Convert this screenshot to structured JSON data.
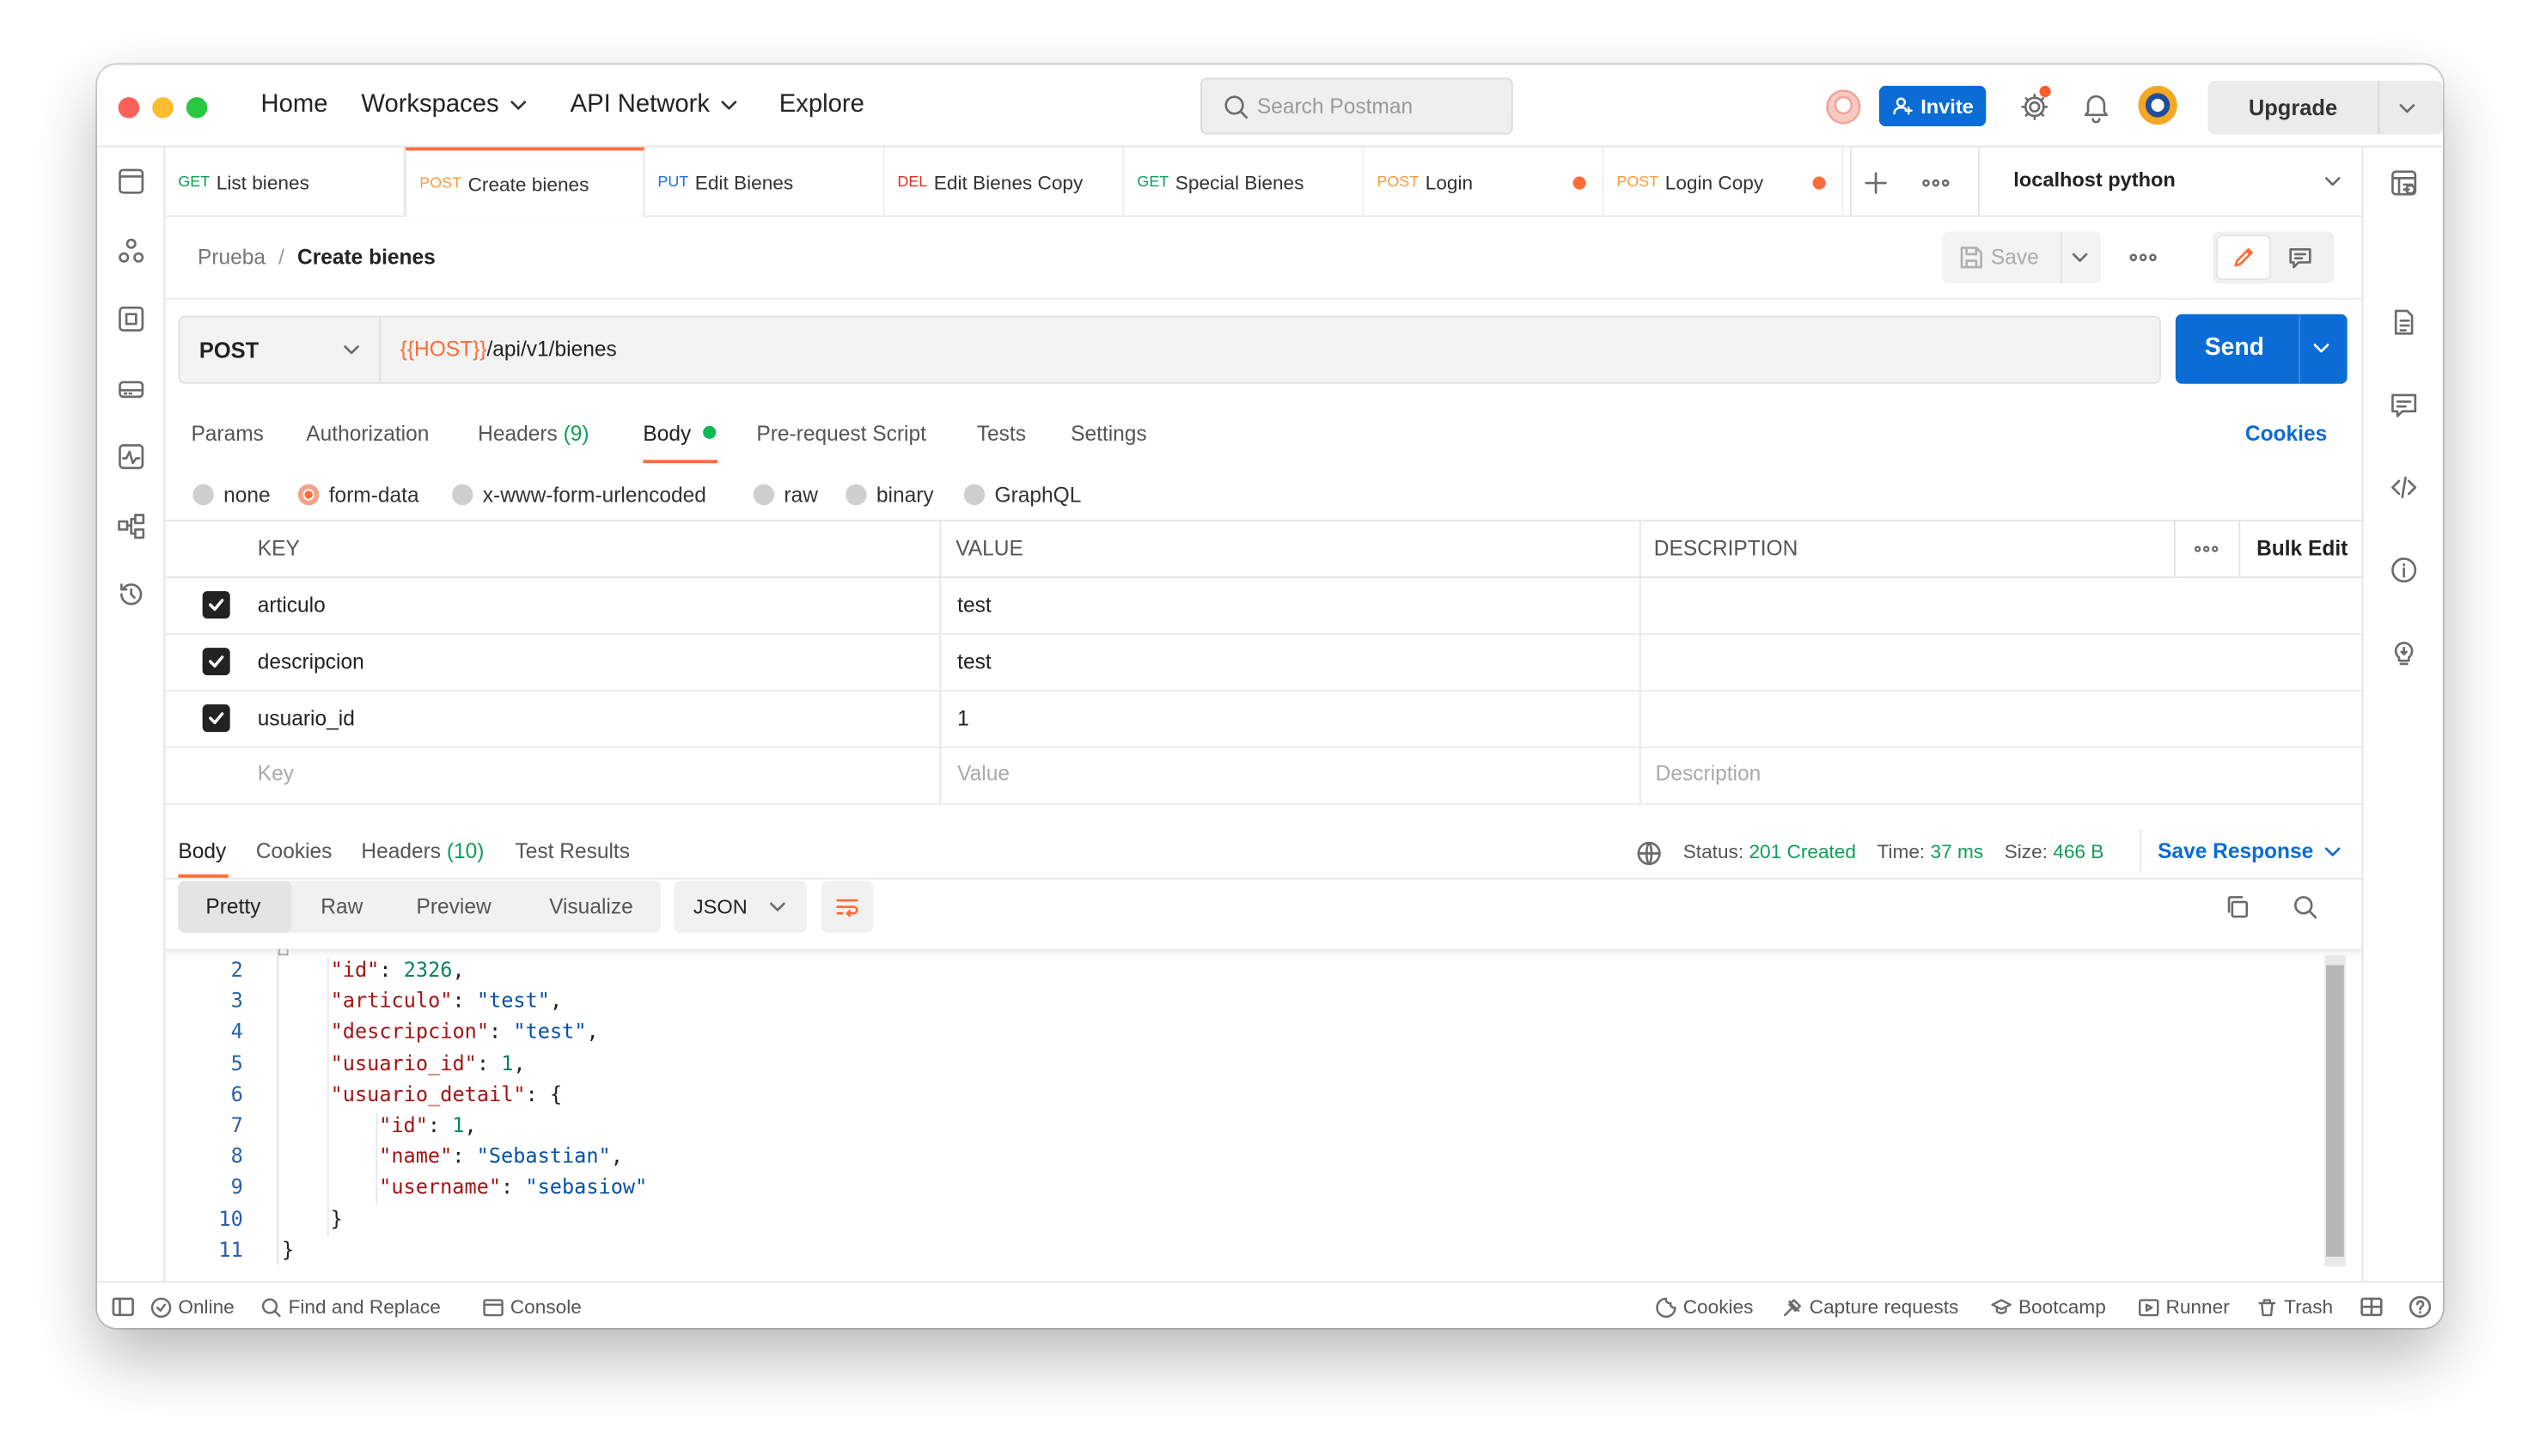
{
  "titlebar": {
    "nav": [
      {
        "label": "Home"
      },
      {
        "label": "Workspaces"
      },
      {
        "label": "API Network"
      },
      {
        "label": "Explore"
      }
    ],
    "search_placeholder": "Search Postman",
    "invite_label": "Invite",
    "upgrade_label": "Upgrade"
  },
  "tabs": [
    {
      "method": "GET",
      "name": "List bienes",
      "color": "#0f9d58",
      "active": false,
      "dot": false
    },
    {
      "method": "POST",
      "name": "Create bienes",
      "color": "#ff9a3c",
      "active": true,
      "dot": false
    },
    {
      "method": "PUT",
      "name": "Edit Bienes",
      "color": "#1a73e8",
      "active": false,
      "dot": false
    },
    {
      "method": "DEL",
      "name": "Edit Bienes Copy",
      "color": "#d93025",
      "active": false,
      "dot": false
    },
    {
      "method": "GET",
      "name": "Special Bienes",
      "color": "#0f9d58",
      "active": false,
      "dot": false
    },
    {
      "method": "POST",
      "name": "Login",
      "color": "#ff9a3c",
      "active": false,
      "dot": true
    },
    {
      "method": "POST",
      "name": "Login Copy",
      "color": "#ff9a3c",
      "active": false,
      "dot": true
    }
  ],
  "environment": "localhost python",
  "breadcrumb": {
    "parent": "Prueba",
    "separator": "/",
    "current": "Create bienes"
  },
  "save_label": "Save",
  "request": {
    "method": "POST",
    "url_var": "{{HOST}}",
    "url_path": "/api/v1/bienes",
    "send_label": "Send"
  },
  "request_tabs": [
    "Params",
    "Authorization",
    "Headers",
    "Body",
    "Pre-request Script",
    "Tests",
    "Settings"
  ],
  "headers_count": "(9)",
  "cookies_label": "Cookies",
  "body_modes": [
    "none",
    "form-data",
    "x-www-form-urlencoded",
    "raw",
    "binary",
    "GraphQL"
  ],
  "form_table": {
    "headers": {
      "key": "KEY",
      "value": "VALUE",
      "description": "DESCRIPTION",
      "bulk_edit": "Bulk Edit"
    },
    "rows": [
      {
        "key": "articulo",
        "value": "test",
        "description": "",
        "checked": true
      },
      {
        "key": "descripcion",
        "value": "test",
        "description": "",
        "checked": true
      },
      {
        "key": "usuario_id",
        "value": "1",
        "description": "",
        "checked": true
      }
    ],
    "placeholders": {
      "key": "Key",
      "value": "Value",
      "description": "Description"
    }
  },
  "response": {
    "tabs": [
      "Body",
      "Cookies",
      "Headers",
      "Test Results"
    ],
    "headers_count": "(10)",
    "status_label": "Status:",
    "status": "201 Created",
    "time_label": "Time:",
    "time": "37 ms",
    "size_label": "Size:",
    "size": "466 B",
    "save_response": "Save Response",
    "view_modes": [
      "Pretty",
      "Raw",
      "Preview",
      "Visualize"
    ],
    "format": "JSON"
  },
  "code_lines": [
    {
      "n": "2",
      "indent": 1,
      "tokens": [
        [
          "k",
          "\"id\""
        ],
        [
          "p",
          ": "
        ],
        [
          "n",
          "2326"
        ],
        [
          "p",
          ","
        ]
      ]
    },
    {
      "n": "3",
      "indent": 1,
      "tokens": [
        [
          "k",
          "\"articulo\""
        ],
        [
          "p",
          ": "
        ],
        [
          "s",
          "\"test\""
        ],
        [
          "p",
          ","
        ]
      ]
    },
    {
      "n": "4",
      "indent": 1,
      "tokens": [
        [
          "k",
          "\"descripcion\""
        ],
        [
          "p",
          ": "
        ],
        [
          "s",
          "\"test\""
        ],
        [
          "p",
          ","
        ]
      ]
    },
    {
      "n": "5",
      "indent": 1,
      "tokens": [
        [
          "k",
          "\"usuario_id\""
        ],
        [
          "p",
          ": "
        ],
        [
          "n",
          "1"
        ],
        [
          "p",
          ","
        ]
      ]
    },
    {
      "n": "6",
      "indent": 1,
      "tokens": [
        [
          "k",
          "\"usuario_detail\""
        ],
        [
          "p",
          ": {"
        ]
      ]
    },
    {
      "n": "7",
      "indent": 2,
      "tokens": [
        [
          "k",
          "\"id\""
        ],
        [
          "p",
          ": "
        ],
        [
          "n",
          "1"
        ],
        [
          "p",
          ","
        ]
      ]
    },
    {
      "n": "8",
      "indent": 2,
      "tokens": [
        [
          "k",
          "\"name\""
        ],
        [
          "p",
          ": "
        ],
        [
          "s",
          "\"Sebastian\""
        ],
        [
          "p",
          ","
        ]
      ]
    },
    {
      "n": "9",
      "indent": 2,
      "tokens": [
        [
          "k",
          "\"username\""
        ],
        [
          "p",
          ": "
        ],
        [
          "s",
          "\"sebasiow\""
        ]
      ]
    },
    {
      "n": "10",
      "indent": 1,
      "tokens": [
        [
          "p",
          "}"
        ]
      ]
    },
    {
      "n": "11",
      "indent": 0,
      "tokens": [
        [
          "p",
          "}"
        ]
      ]
    }
  ],
  "footer": {
    "left": [
      "Online",
      "Find and Replace",
      "Console"
    ],
    "right": [
      "Cookies",
      "Capture requests",
      "Bootcamp",
      "Runner",
      "Trash"
    ]
  }
}
